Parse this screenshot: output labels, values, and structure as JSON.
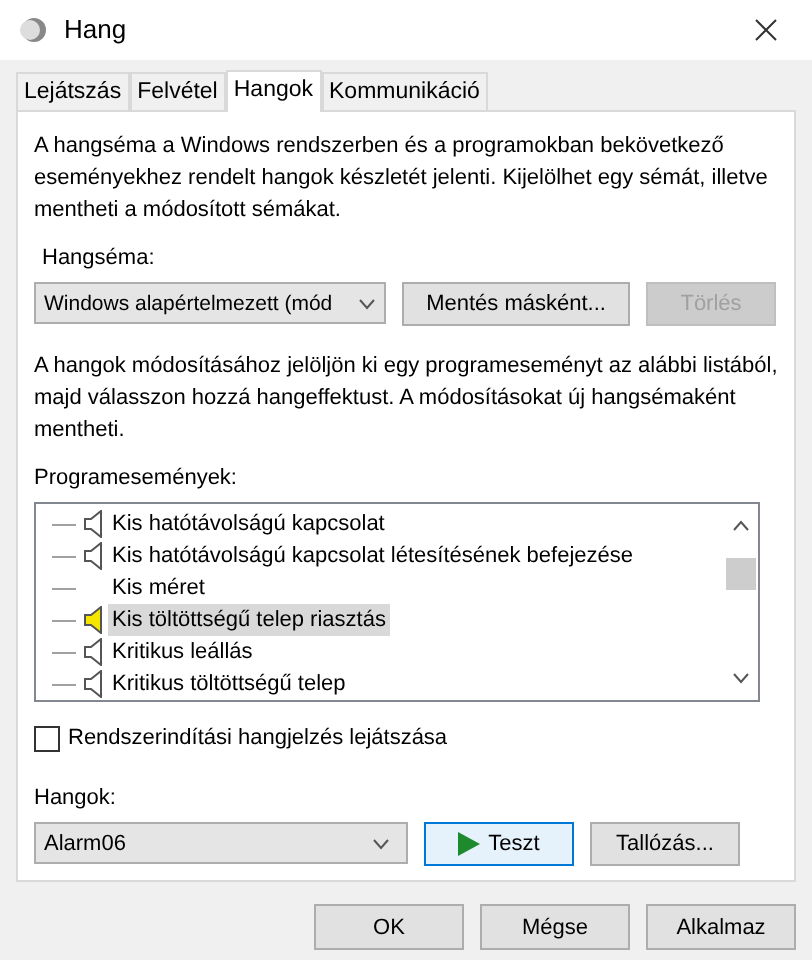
{
  "window": {
    "title": "Hang"
  },
  "tabs": [
    {
      "label": "Lejátszás",
      "selected": false
    },
    {
      "label": "Felvétel",
      "selected": false
    },
    {
      "label": "Hangok",
      "selected": true
    },
    {
      "label": "Kommunikáció",
      "selected": false
    }
  ],
  "description": "A hangséma a Windows rendszerben és a programokban bekövetkező eseményekhez rendelt hangok készletét jelenti. Kijelölhet egy sémát, illetve mentheti a módosított sémákat.",
  "scheme": {
    "label": "Hangséma:",
    "value": "Windows alapértelmezett (mód",
    "buttons": [
      {
        "label": "Mentés másként...",
        "disabled": false
      },
      {
        "label": "Törlés",
        "disabled": true
      }
    ]
  },
  "instructions": "A hangok módosításához jelöljön ki egy programeseményt az alábbi listából, majd válasszon hozzá hangeffektust. A módosításokat új hangsémaként mentheti.",
  "events": {
    "label": "Programesemények:",
    "items": [
      {
        "label": "Kis hatótávolságú kapcsolat",
        "kind": "sound",
        "selected": false
      },
      {
        "label": "Kis hatótávolságú kapcsolat létesítésének befejezése",
        "kind": "sound",
        "selected": false
      },
      {
        "label": "Kis méret",
        "kind": "none",
        "selected": false
      },
      {
        "label": "Kis töltöttségű telep riasztás",
        "kind": "sound",
        "selected": true
      },
      {
        "label": "Kritikus leállás",
        "kind": "sound",
        "selected": false
      },
      {
        "label": "Kritikus töltöttségű telep",
        "kind": "sound",
        "selected": false
      }
    ]
  },
  "startup_sound": {
    "label": "Rendszerindítási hangjelzés lejátszása",
    "checked": false
  },
  "sounds": {
    "label": "Hangok:",
    "value": "Alarm06",
    "test_button": "Teszt",
    "browse_button": "Tallózás..."
  },
  "buttons": [
    "OK",
    "Mégse",
    "Alkalmaz"
  ]
}
